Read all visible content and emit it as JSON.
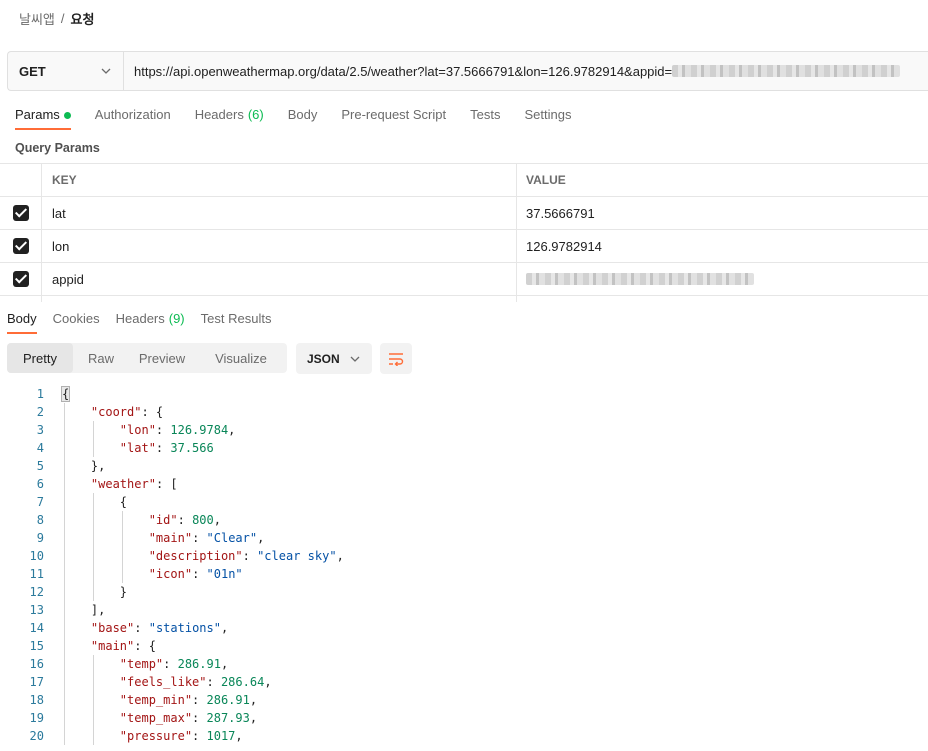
{
  "breadcrumb": {
    "parent": "날씨앱",
    "separator": "/",
    "current": "요청"
  },
  "request": {
    "method": "GET",
    "url": "https://api.openweathermap.org/data/2.5/weather?lat=37.5666791&lon=126.9782914&appid="
  },
  "request_tabs": [
    {
      "label": "Params",
      "active": true,
      "dot": true
    },
    {
      "label": "Authorization"
    },
    {
      "label": "Headers",
      "count": "(6)"
    },
    {
      "label": "Body"
    },
    {
      "label": "Pre-request Script"
    },
    {
      "label": "Tests"
    },
    {
      "label": "Settings"
    }
  ],
  "query_params": {
    "title": "Query Params",
    "headers": {
      "key": "KEY",
      "value": "VALUE"
    },
    "rows": [
      {
        "key": "lat",
        "value": "37.5666791",
        "checked": true
      },
      {
        "key": "lon",
        "value": "126.9782914",
        "checked": true
      },
      {
        "key": "appid",
        "value": "",
        "checked": true
      }
    ]
  },
  "response_tabs": [
    {
      "label": "Body",
      "active": true
    },
    {
      "label": "Cookies"
    },
    {
      "label": "Headers",
      "count": "(9)"
    },
    {
      "label": "Test Results"
    }
  ],
  "view_modes": [
    "Pretty",
    "Raw",
    "Preview",
    "Visualize"
  ],
  "active_view": "Pretty",
  "format": "JSON",
  "code_lines": [
    {
      "n": "1",
      "t": "{"
    },
    {
      "n": "2",
      "t": "    \"coord\": {"
    },
    {
      "n": "3",
      "t": "        \"lon\": 126.9784,"
    },
    {
      "n": "4",
      "t": "        \"lat\": 37.566"
    },
    {
      "n": "5",
      "t": "    },"
    },
    {
      "n": "6",
      "t": "    \"weather\": ["
    },
    {
      "n": "7",
      "t": "        {"
    },
    {
      "n": "8",
      "t": "            \"id\": 800,"
    },
    {
      "n": "9",
      "t": "            \"main\": \"Clear\","
    },
    {
      "n": "10",
      "t": "            \"description\": \"clear sky\","
    },
    {
      "n": "11",
      "t": "            \"icon\": \"01n\""
    },
    {
      "n": "12",
      "t": "        }"
    },
    {
      "n": "13",
      "t": "    ],"
    },
    {
      "n": "14",
      "t": "    \"base\": \"stations\","
    },
    {
      "n": "15",
      "t": "    \"main\": {"
    },
    {
      "n": "16",
      "t": "        \"temp\": 286.91,"
    },
    {
      "n": "17",
      "t": "        \"feels_like\": 286.64,"
    },
    {
      "n": "18",
      "t": "        \"temp_min\": 286.91,"
    },
    {
      "n": "19",
      "t": "        \"temp_max\": 287.93,"
    },
    {
      "n": "20",
      "t": "        \"pressure\": 1017,"
    }
  ],
  "colors": {
    "accent": "#ff6c37",
    "active_dot": "#0cbb52",
    "json_key": "#a31515",
    "json_string": "#0451a5",
    "json_number": "#098658"
  },
  "icons": {
    "method_dropdown": "chevron-down-icon",
    "format_dropdown": "chevron-down-icon",
    "wrap": "wrap-lines-icon",
    "checkbox": "checkbox-checked-icon"
  }
}
